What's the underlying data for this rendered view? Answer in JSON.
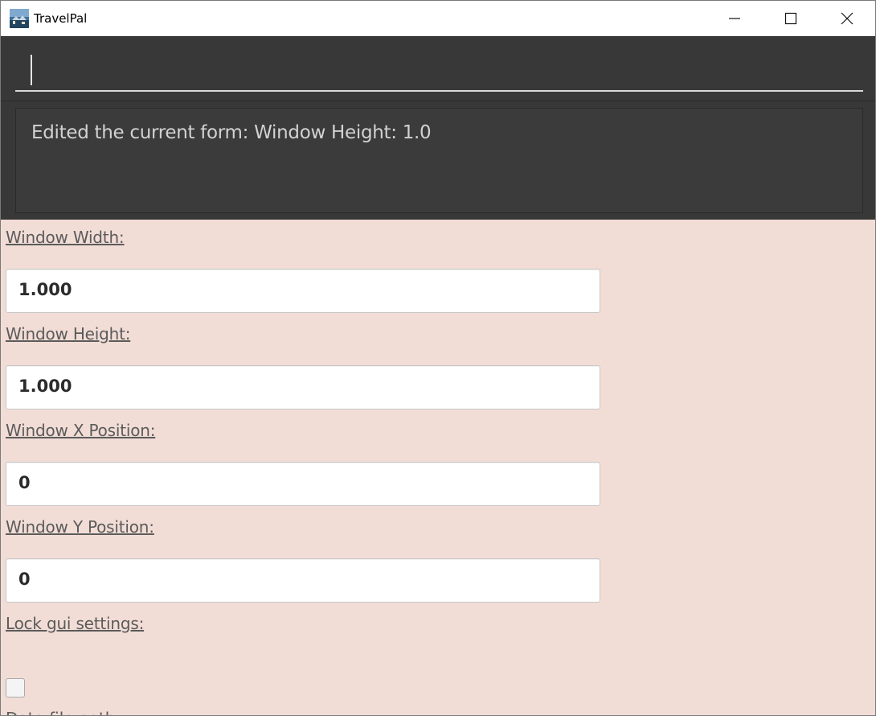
{
  "window": {
    "title": "TravelPal",
    "icon": "travelpal-app-icon",
    "controls": [
      "minimize-icon",
      "maximize-icon",
      "close-icon"
    ]
  },
  "command": {
    "value": ""
  },
  "result": {
    "message": "Edited the current form: Window Height: 1.0"
  },
  "form": {
    "fields": [
      {
        "label": "Window Width: ",
        "value": "1.000"
      },
      {
        "label": "Window Height: ",
        "value": "1.000"
      },
      {
        "label": "Window X Position: ",
        "value": "0"
      },
      {
        "label": "Window Y Position: ",
        "value": "0"
      }
    ],
    "lock_label": "Lock gui settings: ",
    "lock_checked": false,
    "next_label": "Data file path:"
  },
  "colors": {
    "dark_panel": "#383838",
    "form_background": "#f2ddd6",
    "label_text": "#5b5b5b"
  }
}
